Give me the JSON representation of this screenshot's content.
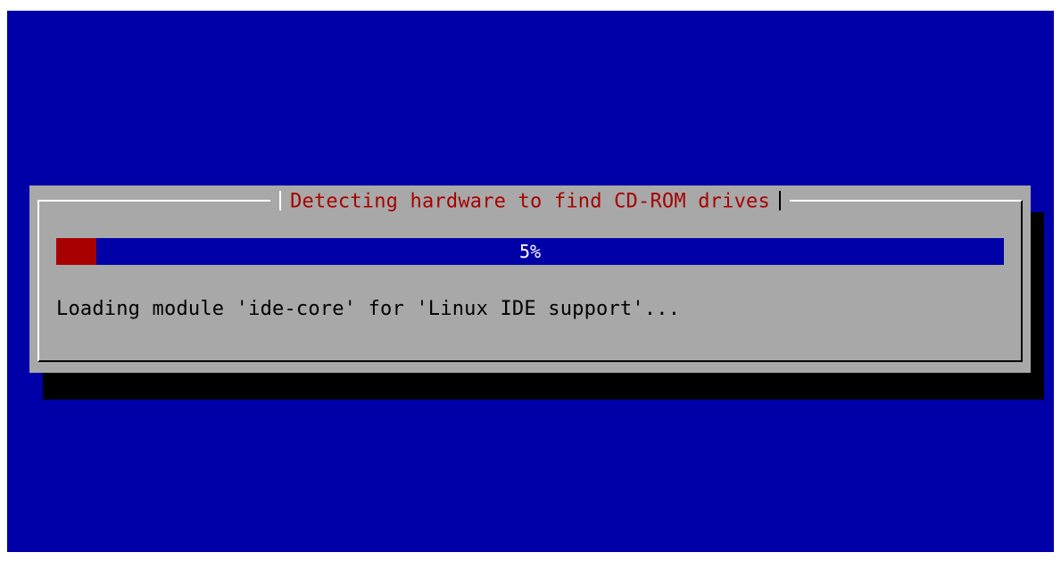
{
  "dialog": {
    "title": "Detecting hardware to find CD-ROM drives",
    "progress": {
      "percent": 5,
      "label": "5%"
    },
    "status_text": "Loading module 'ide-core' for 'Linux IDE support'..."
  },
  "colors": {
    "background": "#0000a8",
    "dialog": "#a8a8a8",
    "title": "#a80000",
    "progress_fill": "#a80000",
    "progress_track": "#0000a8",
    "shadow": "#000000"
  }
}
